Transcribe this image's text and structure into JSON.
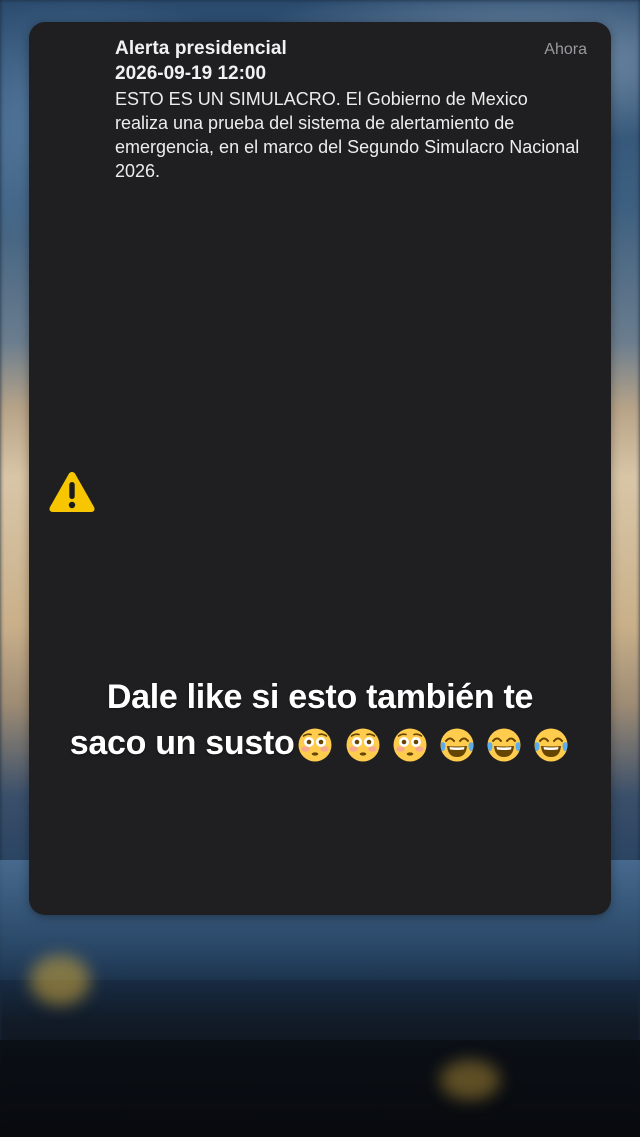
{
  "notification": {
    "title": "Alerta presidencial",
    "time": "Ahora",
    "datetime": "2026-09-19 12:00",
    "body": "ESTO ES UN SIMULACRO. El Gobierno de Mexico realiza una prueba del sistema de alertamiento de emergencia, en el marco del Segundo Simulacro Nacional 2026.",
    "icon": "warning-icon"
  },
  "caption": {
    "line1": "Dale like si esto también te",
    "line2": "saco un susto",
    "emojis": [
      "flushed-face",
      "flushed-face",
      "flushed-face",
      "tears-of-joy",
      "tears-of-joy",
      "tears-of-joy"
    ]
  },
  "colors": {
    "card_background": "#1f1f21",
    "warning_yellow": "#f7c600",
    "secondary_text": "#9a9a9e"
  }
}
